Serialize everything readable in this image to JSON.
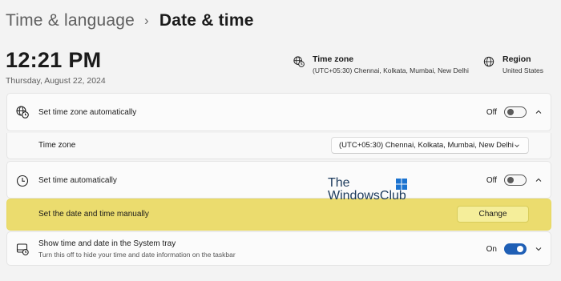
{
  "breadcrumb": {
    "parent": "Time & language",
    "separator": "›",
    "current": "Date & time"
  },
  "clock": {
    "time": "12:21 PM",
    "date": "Thursday, August 22, 2024"
  },
  "time_zone_info": {
    "title": "Time zone",
    "value": "(UTC+05:30) Chennai, Kolkata, Mumbai, New Delhi",
    "icon": "globe-clock-icon"
  },
  "region_info": {
    "title": "Region",
    "value": "United States",
    "icon": "globe-icon"
  },
  "rows": {
    "set_time_zone_auto": {
      "label": "Set time zone automatically",
      "state": "Off",
      "icon": "globe-clock-icon"
    },
    "time_zone": {
      "label": "Time zone",
      "selected": "(UTC+05:30) Chennai, Kolkata, Mumbai, New Delhi"
    },
    "set_time_auto": {
      "label": "Set time automatically",
      "state": "Off",
      "icon": "clock-icon"
    },
    "set_manual": {
      "label": "Set the date and time manually",
      "button": "Change"
    },
    "system_tray": {
      "label": "Show time and date in the System tray",
      "sub": "Turn this off to hide your time and date information on the taskbar",
      "state": "On",
      "icon": "taskbar-clock-icon"
    }
  },
  "watermark": {
    "line1": "The",
    "line2": "WindowsClub"
  },
  "colors": {
    "accent": "#1f5fb5",
    "highlight": "#ebdc6e",
    "background": "#f3f3f3"
  }
}
